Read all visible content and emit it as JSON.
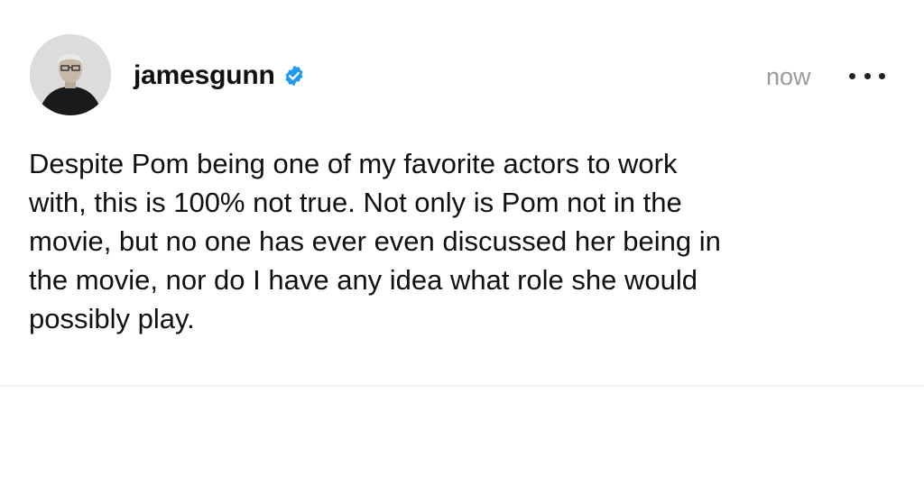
{
  "post": {
    "username": "jamesgunn",
    "verified": true,
    "timestamp": "now",
    "more_icon": "ellipsis-icon",
    "body_lines": [
      "Despite Pom being one of my favorite actors to work",
      "with, this is 100% not true. Not only is Pom not in the",
      "movie, but no one has ever even discussed her being in",
      "the movie, nor do I have any idea what role she would",
      "possibly play."
    ]
  },
  "colors": {
    "verified_badge": "#1d9bf0",
    "timestamp": "#9a9a9a",
    "text": "#101010"
  }
}
